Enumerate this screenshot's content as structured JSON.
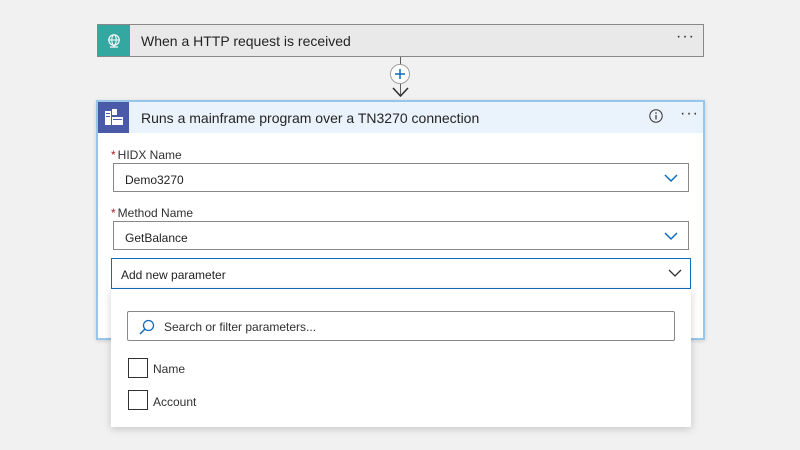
{
  "trigger": {
    "title": "When a HTTP request is received",
    "icon": "globe-request-icon",
    "more_label": "···",
    "accent": "#34a7a1"
  },
  "connector": {
    "add_icon": "plus-icon"
  },
  "action": {
    "title": "Runs a mainframe program over a TN3270 connection",
    "icon": "host-integration-icon",
    "info_icon": "info-icon",
    "more_label": "···",
    "accent": "#4a5aa8",
    "fields": {
      "hidx": {
        "label": "HIDX Name",
        "required_mark": "*",
        "value": "Demo3270"
      },
      "method": {
        "label": "Method Name",
        "required_mark": "*",
        "value": "GetBalance"
      },
      "add_param": {
        "label": "Add new parameter"
      }
    }
  },
  "param_panel": {
    "search_placeholder": "Search or filter parameters...",
    "options": [
      {
        "label": "Name",
        "checked": false
      },
      {
        "label": "Account",
        "checked": false
      }
    ]
  }
}
